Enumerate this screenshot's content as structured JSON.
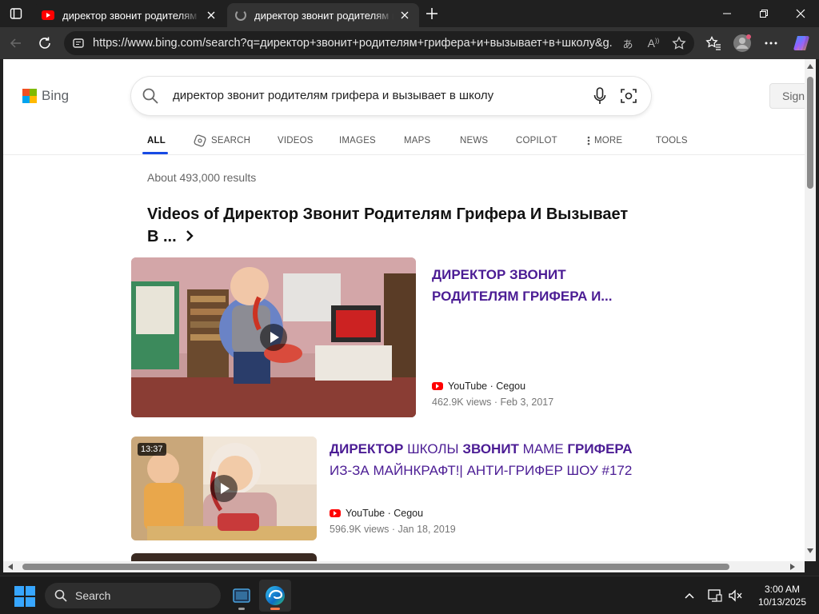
{
  "tabs": [
    {
      "title": "директор звонит родителям грифера и вызывает в школу - YouTube",
      "state": "inactive",
      "favicon": "youtube-icon"
    },
    {
      "title": "директор звонит родителям грифера и вызывает в школу - Bing",
      "state": "active",
      "favicon": "loading-icon"
    }
  ],
  "address": {
    "url": "https://www.bing.com/search?q=директор+звонит+родителям+грифера+и+вызывает+в+школу&g..."
  },
  "bing": {
    "logo_text": "Bing",
    "query": "директор звонит родителям грифера и вызывает в школу",
    "signin": "Sign in",
    "nav": [
      {
        "label": "ALL",
        "active": true
      },
      {
        "label": "SEARCH",
        "icon": "copilot-search-icon"
      },
      {
        "label": "VIDEOS"
      },
      {
        "label": "IMAGES"
      },
      {
        "label": "MAPS"
      },
      {
        "label": "NEWS"
      },
      {
        "label": "COPILOT"
      },
      {
        "label": "MORE",
        "icon": "kebab-icon"
      },
      {
        "label": "TOOLS"
      }
    ],
    "results_count": "About 493,000 results",
    "section_title": "Videos of Директор Звонит Родителям Грифера И Вызывает В ...",
    "videos": [
      {
        "title": "ДИРЕКТОР ЗВОНИТ РОДИТЕЛЯМ ГРИФЕРА И...",
        "source": "YouTube · Cegou",
        "meta": "462.9K views · Feb 3, 2017"
      },
      {
        "duration": "13:37",
        "title_parts": [
          "ДИРЕКТОР",
          " ШКОЛЫ ",
          "ЗВОНИТ",
          " МАМЕ ",
          "ГРИФЕРА",
          " ИЗ-ЗА МАЙНКРАФТ!| АНТИ-ГРИФЕР ШОУ #172"
        ],
        "source": "YouTube · Cegou",
        "meta": "596.9K views · Jan 18, 2019"
      }
    ]
  },
  "taskbar": {
    "search_label": "Search",
    "time": "3:00 AM",
    "date": "10/13/2025"
  },
  "colors": {
    "link_purple": "#4b1c94",
    "accent_blue": "#174ae4",
    "youtube_red": "#ff0000"
  }
}
